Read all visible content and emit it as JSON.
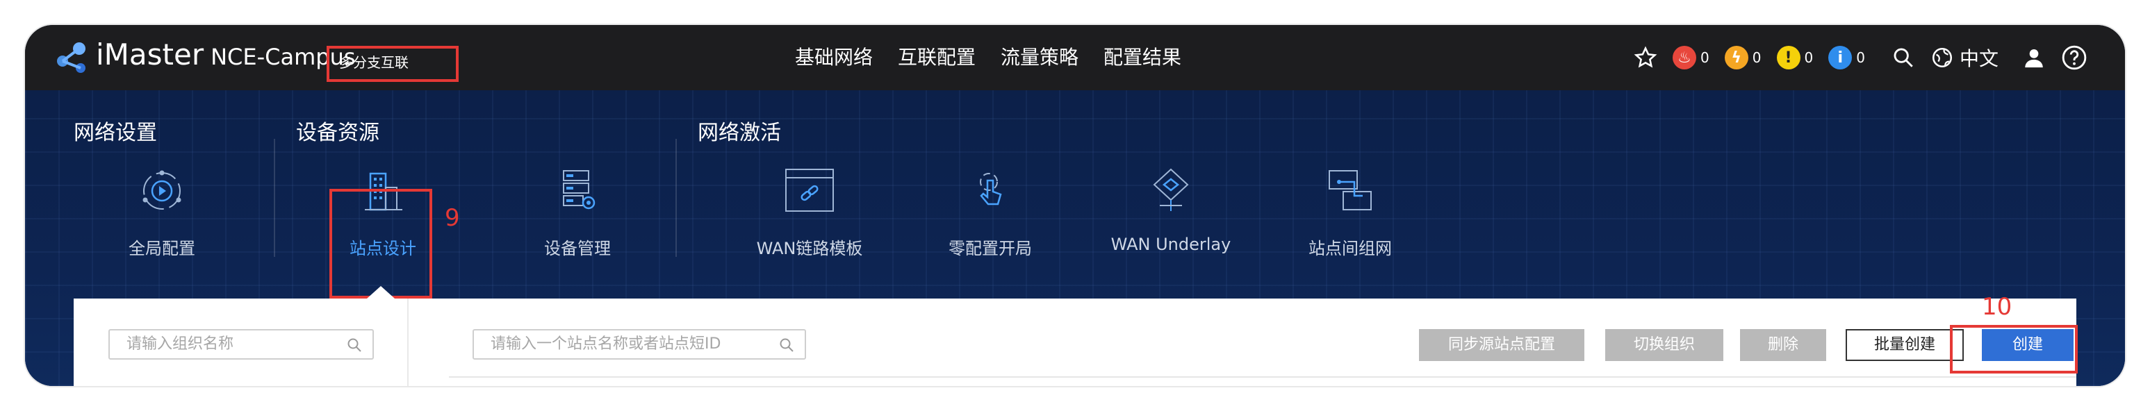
{
  "app": {
    "brand_name": "iMaster",
    "brand_product": "NCE-Campus",
    "context_label": "多分支互联"
  },
  "nav": {
    "items": [
      "基础网络",
      "互联配置",
      "流量策略",
      "配置结果"
    ]
  },
  "toolbar": {
    "alarm_critical": "0",
    "alarm_major": "0",
    "alarm_minor": "0",
    "alarm_info": "0",
    "language": "中文",
    "colors": {
      "critical": "#e8473c",
      "major": "#f5a623",
      "minor": "#f5d10b",
      "info": "#2f8ded"
    }
  },
  "sections": {
    "network_settings": "网络设置",
    "device_resources": "设备资源",
    "network_activation": "网络激活"
  },
  "features": {
    "global_config": "全局配置",
    "site_design": "站点设计",
    "device_management": "设备管理",
    "wan_link_template": "WAN链路模板",
    "zero_touch": "零配置开局",
    "wan_underlay": "WAN Underlay",
    "site_interconnect": "站点间组网"
  },
  "annotations": {
    "step_9": "9",
    "step_10": "10"
  },
  "content": {
    "org_search_placeholder": "请输入组织名称",
    "site_search_placeholder": "请输入一个站点名称或者站点短ID",
    "buttons": {
      "sync_source_site": "同步源站点配置",
      "switch_org": "切换组织",
      "delete": "删除",
      "batch_create": "批量创建",
      "create": "创建"
    },
    "accent_color": "#2f6fd6"
  }
}
